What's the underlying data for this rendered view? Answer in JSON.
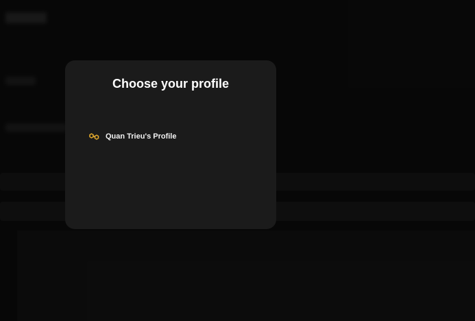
{
  "modal": {
    "title": "Choose your profile",
    "profiles": [
      {
        "label": "Quan Trieu's Profile",
        "icon": "polygon-link-icon",
        "icon_color": "#e0a72c"
      }
    ]
  },
  "colors": {
    "background": "#0c0c0c",
    "modal_background": "#1b1b1b",
    "accent": "#e0a72c"
  }
}
